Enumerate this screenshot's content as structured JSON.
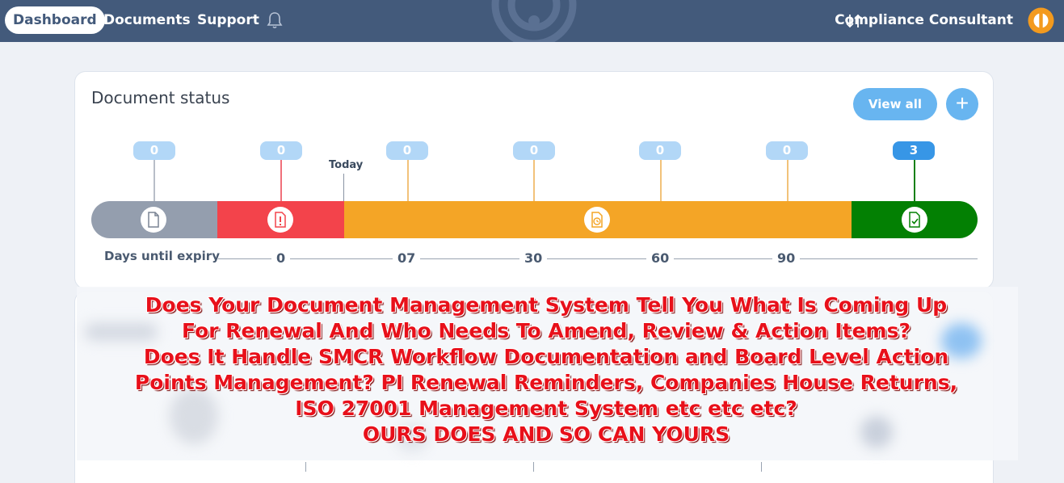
{
  "nav": {
    "tabs": [
      {
        "label": "Dashboard",
        "active": true
      },
      {
        "label": "Documents"
      },
      {
        "label": "Support"
      }
    ],
    "role_label": "Compliance Consultant",
    "bell_icon": "bell-icon",
    "swap_icon": "sort-arrows-icon",
    "avatar_icon": "user-avatar-icon",
    "colors": {
      "bar": "#435a7b",
      "avatar": "#f39a1e"
    }
  },
  "document_status": {
    "title": "Document status",
    "view_all_label": "View all",
    "add_label": "+",
    "today_label": "Today",
    "axis_title": "Days until expiry",
    "counts": [
      {
        "value": "0",
        "stem_color": "#b8bec8"
      },
      {
        "value": "0",
        "stem_color": "#f0707a"
      },
      {
        "value": "0",
        "stem_color": "#f2c27a"
      },
      {
        "value": "0",
        "stem_color": "#f2c27a"
      },
      {
        "value": "0",
        "stem_color": "#f2c27a"
      },
      {
        "value": "0",
        "stem_color": "#f2c27a"
      },
      {
        "value": "3",
        "stem_color": "#118011"
      }
    ],
    "segments": [
      {
        "name": "no-expiry",
        "color": "#949eae",
        "icon": "document-icon"
      },
      {
        "name": "expired",
        "color": "#f3434b",
        "icon": "alert-document-icon"
      },
      {
        "name": "expiring",
        "color": "#f4a526",
        "icon": "clock-document-icon"
      },
      {
        "name": "valid",
        "color": "#038003",
        "icon": "check-document-icon"
      }
    ],
    "axis_ticks": [
      "0",
      "07",
      "30",
      "60",
      "90"
    ]
  },
  "promo": {
    "lines": [
      "Does Your Document Management System Tell You What Is Coming Up",
      "For Renewal And Who Needs To Amend, Review & Action Items?",
      "Does It Handle SMCR Workflow Documentation and Board Level Action",
      "Points Management? PI Renewal Reminders, Companies House Returns,",
      "ISO 27001 Management System etc etc etc?",
      "OURS DOES AND SO CAN YOURS"
    ],
    "color": "#e8101a"
  }
}
